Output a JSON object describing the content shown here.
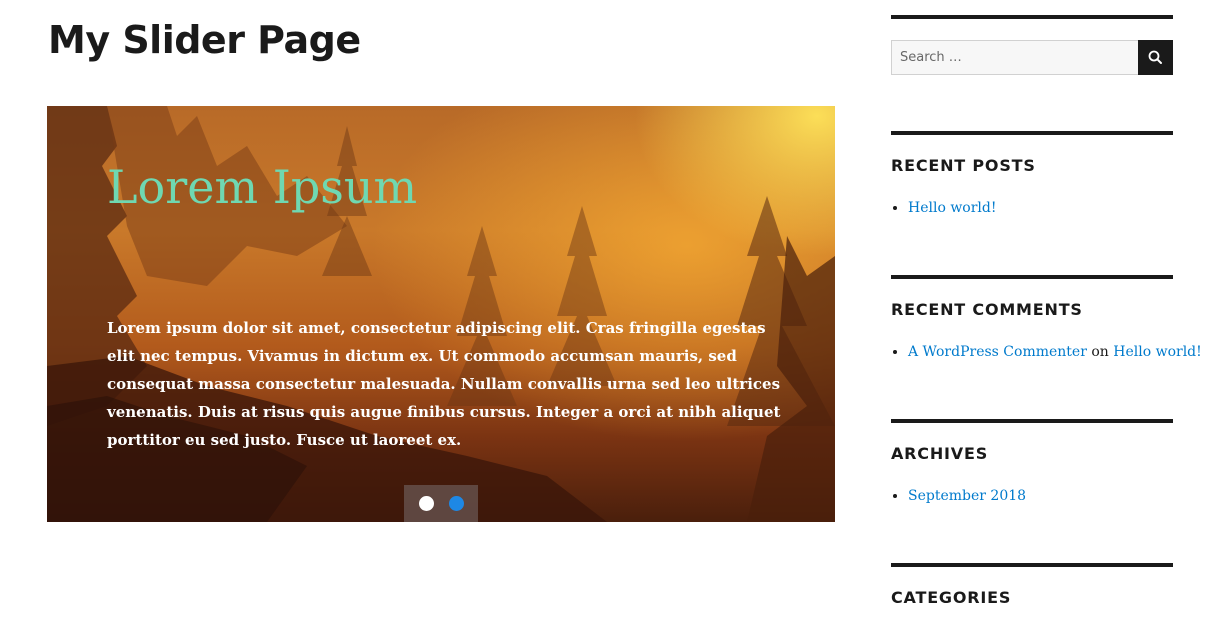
{
  "page": {
    "title": "My Slider Page"
  },
  "slider": {
    "heading": "Lorem Ipsum",
    "text": "Lorem ipsum dolor sit amet, consectetur adipiscing elit. Cras fringilla egestas elit nec tempus. Vivamus in dictum ex. Ut commodo accumsan mauris, sed consequat massa consectetur malesuada. Nullam convallis urna sed leo ultrices venenatis. Duis at risus quis augue finibus cursus. Integer a orci at nibh aliquet porttitor eu sed justo. Fusce ut laoreet ex.",
    "heading_color": "#6fd8b1",
    "active_dot_color": "#1e88e5",
    "dots": 2,
    "active_dot": 2
  },
  "sidebar": {
    "search": {
      "placeholder": "Search …",
      "button_icon": "search-icon"
    },
    "recent_posts": {
      "title": "RECENT POSTS",
      "items": [
        "Hello world!"
      ]
    },
    "recent_comments": {
      "title": "RECENT COMMENTS",
      "author": "A WordPress Commenter",
      "connector": "on",
      "post": "Hello world!"
    },
    "archives": {
      "title": "ARCHIVES",
      "items": [
        "September 2018"
      ]
    },
    "categories": {
      "title": "CATEGORIES"
    }
  },
  "colors": {
    "link": "#007acc",
    "text": "#1a1a1a"
  }
}
